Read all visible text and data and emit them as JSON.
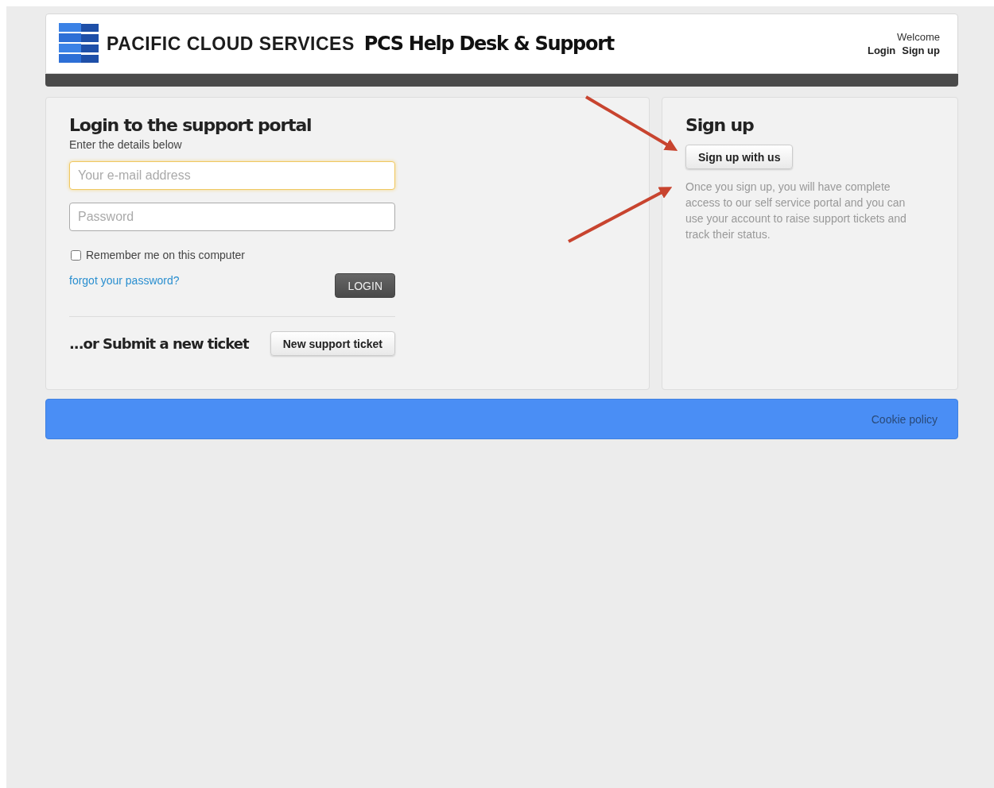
{
  "header": {
    "brand": "PACIFIC CLOUD SERVICES",
    "title": "PCS Help Desk & Support",
    "welcome": "Welcome",
    "links": [
      "Login",
      "Sign up"
    ]
  },
  "login": {
    "title": "Login to the support portal",
    "subtitle": "Enter the details below",
    "fields": [
      {
        "placeholder": "Your e-mail address",
        "focused": true
      },
      {
        "placeholder": "Password",
        "focused": false
      }
    ],
    "remember": {
      "label": "Remember me on this computer",
      "checked": false
    },
    "forgot": "forgot your password?",
    "button": "LOGIN",
    "submit_title": "...or Submit a new ticket",
    "ticket_button": "New support ticket"
  },
  "signup": {
    "title": "Sign up",
    "button": "Sign up with us",
    "description": "Once you sign up, you will have complete access to our self service portal and you can use your account to raise support tickets and track their status."
  },
  "footer": {
    "link": "Cookie policy"
  }
}
